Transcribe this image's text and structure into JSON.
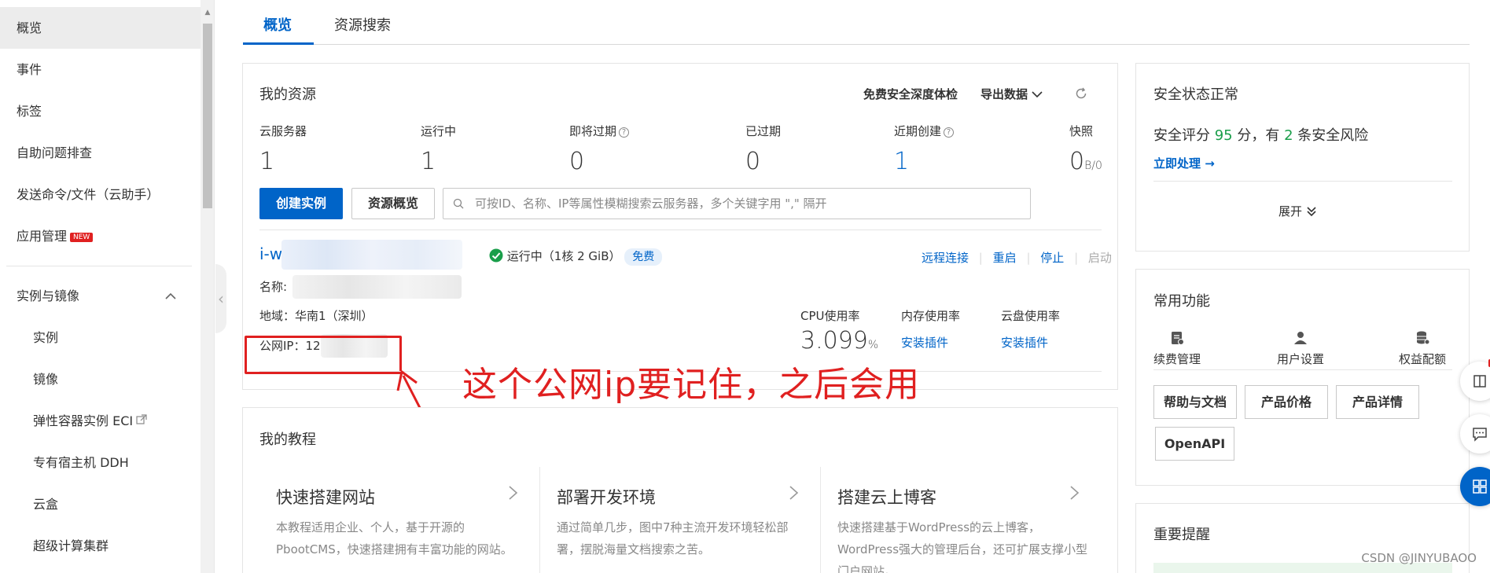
{
  "sidebar": {
    "items": [
      {
        "label": "概览"
      },
      {
        "label": "事件"
      },
      {
        "label": "标签"
      },
      {
        "label": "自助问题排查"
      },
      {
        "label": "发送命令/文件（云助手）"
      },
      {
        "label": "应用管理"
      }
    ],
    "new_badge": "NEW",
    "group_label": "实例与镜像",
    "sub_items": [
      {
        "label": "实例"
      },
      {
        "label": "镜像"
      },
      {
        "label": "弹性容器实例 ECI"
      },
      {
        "label": "专有宿主机 DDH"
      },
      {
        "label": "云盒"
      },
      {
        "label": "超级计算集群"
      }
    ]
  },
  "tabs": [
    {
      "label": "概览"
    },
    {
      "label": "资源搜索"
    }
  ],
  "resources": {
    "title": "我的资源",
    "free_check": "免费安全深度体检",
    "export": "导出数据",
    "stats": [
      {
        "label": "云服务器",
        "value": "1"
      },
      {
        "label": "运行中",
        "value": "1"
      },
      {
        "label": "即将过期",
        "value": "0"
      },
      {
        "label": "已过期",
        "value": "0"
      },
      {
        "label": "近期创建",
        "value": "1"
      },
      {
        "label": "快照",
        "value": "0",
        "unit": "B/0"
      }
    ],
    "create_button": "创建实例",
    "overview_button": "资源概览",
    "search_placeholder": "可按ID、名称、IP等属性模糊搜索云服务器，多个关键字用 \",\" 隔开"
  },
  "instance": {
    "id_prefix": "i-w",
    "status": "运行中（1核 2 GiB）",
    "free_badge": "免费",
    "actions": [
      "远程连接",
      "重启",
      "停止",
      "启动"
    ],
    "name_label": "名称:",
    "region": "地域：华南1（深圳）",
    "public_ip_label": "公网IP：",
    "public_ip_partial": "12",
    "cpu_label": "CPU使用率",
    "cpu_value": "3.099",
    "cpu_unit": "%",
    "mem_label": "内存使用率",
    "mem_value": "安装插件",
    "disk_label": "云盘使用率",
    "disk_value": "安装插件"
  },
  "annotation": "这个公网ip要记住，之后会用",
  "tutorials": {
    "title": "我的教程",
    "items": [
      {
        "title": "快速搭建网站",
        "desc": "本教程适用企业、个人，基于开源的PbootCMS，快速搭建拥有丰富功能的网站。"
      },
      {
        "title": "部署开发环境",
        "desc": "通过简单几步，图中7种主流开发环境轻松部署，摆脱海量文档搜索之苦。"
      },
      {
        "title": "搭建云上博客",
        "desc": "快速搭建基于WordPress的云上博客，WordPress强大的管理后台，还可扩展支撑小型门户网站。"
      }
    ]
  },
  "security": {
    "title": "安全状态正常",
    "score_prefix": "安全评分",
    "score": "95",
    "score_mid": "分，有",
    "risks": "2",
    "score_suffix": "条安全风险",
    "action": "立即处理 →",
    "expand": "展开"
  },
  "common": {
    "title": "常用功能",
    "items": [
      {
        "label": "续费管理",
        "icon": "renew-icon"
      },
      {
        "label": "用户设置",
        "icon": "user-icon"
      },
      {
        "label": "权益配额",
        "icon": "database-icon"
      }
    ],
    "buttons": [
      "帮助与文档",
      "产品价格",
      "产品详情",
      "OpenAPI"
    ]
  },
  "reminder": {
    "title": "重要提醒"
  },
  "watermark": "CSDN @JINYUBAOO",
  "colors": {
    "accent": "#0064c8",
    "success": "#1a9e4a",
    "annotation": "#e02020"
  }
}
